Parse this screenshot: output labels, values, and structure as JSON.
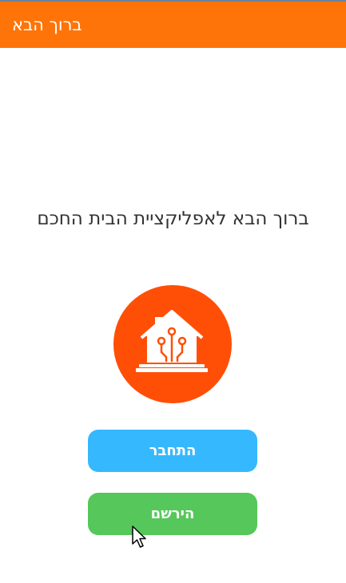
{
  "app_bar": {
    "title": "ברוך הבא"
  },
  "welcome": {
    "text": "ברוך הבא לאפליקציית הבית החכם"
  },
  "logo": {
    "icon": "smart-home-icon",
    "color": "#ff4f06"
  },
  "buttons": {
    "login_label": "התחבר",
    "register_label": "הירשם"
  },
  "colors": {
    "app_bar": "#ff7409",
    "login_button": "#35b8fe",
    "register_button": "#56c75a"
  }
}
